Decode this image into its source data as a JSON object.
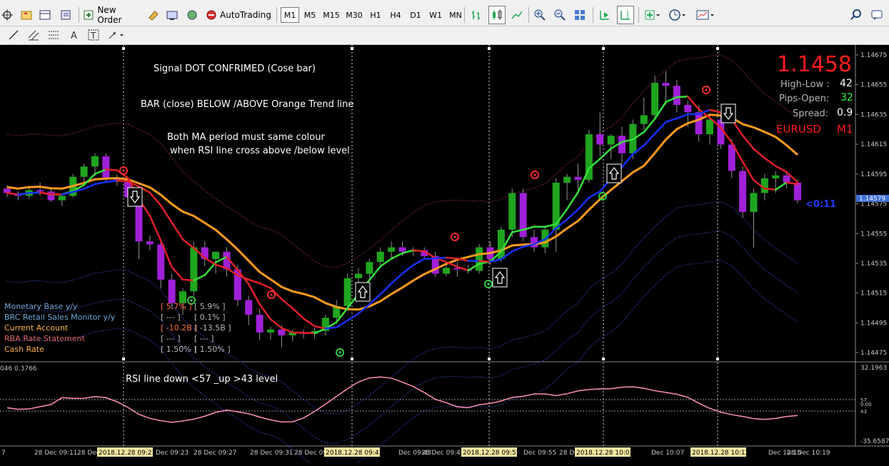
{
  "toolbar": {
    "new_order": "New Order",
    "autotrading": "AutoTrading",
    "timeframes": [
      "M1",
      "M5",
      "M15",
      "M30",
      "H1",
      "H4",
      "D1",
      "W1",
      "MN"
    ],
    "active_timeframe": "M1"
  },
  "overlay_text": {
    "line1": "Signal DOT CONFRIMED (Cose bar)",
    "line2": "BAR (close) BELOW /ABOVE Orange Trend line",
    "line3": "Both MA period must same colour",
    "line4": "when RSI line cross above /below level",
    "rsi_note": "RSI line  down <57 _up >43 level"
  },
  "info_panel": {
    "price": "1.1458",
    "high_low_label": "High-Low :",
    "high_low_value": "42",
    "pips_open_label": "Pips-Open:",
    "pips_open_value": "32",
    "spread_label": "Spread:",
    "spread_value": "0.9",
    "symbol": "EURUSD",
    "timeframe": "M1",
    "countdown": "<0:11"
  },
  "news_panel": [
    {
      "name": "Monetary Base y/y",
      "actual": "",
      "forecast": "",
      "color": "#6fa8dc"
    },
    {
      "name": "BRC Retail Sales Monitor y/y",
      "actual": "",
      "forecast": "",
      "color": "#6fa8dc"
    },
    {
      "name": "Current Account",
      "actual": "[ -10.2B ]",
      "forecast": "[ -13.5B ]",
      "color": "#ffb347"
    },
    {
      "name": "RBA Rate Statement",
      "actual": "[ --- ]",
      "forecast": "[ --- ]",
      "color": "#e06666"
    },
    {
      "name": "Cash Rate",
      "actual": "[ 1.50% ]",
      "forecast": "[ 1.50% ]",
      "color": "#ffb347"
    }
  ],
  "news_values_top": [
    {
      "actual": "[ 5.7% ]",
      "forecast": "[ 5.9% ]"
    },
    {
      "actual": "[ --- ]",
      "forecast": "[ 0.1% ]"
    }
  ],
  "rsi_header": "046 0.3766",
  "chart_data": {
    "type": "candlestick",
    "symbol": "EURUSD",
    "price_axis": [
      "1.14675",
      "1.14655",
      "1.14635",
      "1.14615",
      "1.14595",
      "1.14575",
      "1.14555",
      "1.14535",
      "1.14515",
      "1.14495",
      "1.14475"
    ],
    "current_price_label": "1.14579",
    "price_range": [
      1.1447,
      1.1468
    ],
    "time_axis": [
      {
        "label": "7",
        "highlight": false
      },
      {
        "label": "28 Dec 09:11",
        "highlight": false
      },
      {
        "label": "28 Dec 09:15",
        "highlight": false
      },
      {
        "label": "2018.12.28 09:21",
        "highlight": true
      },
      {
        "label": "Dec 09:23",
        "highlight": false
      },
      {
        "label": "28 Dec 09:27",
        "highlight": false
      },
      {
        "label": "28 Dec 09:31",
        "highlight": false
      },
      {
        "label": "28 Dec 09:35",
        "highlight": false
      },
      {
        "label": "2018.12.28 09:41",
        "highlight": true
      },
      {
        "label": "Dec 09:43",
        "highlight": false
      },
      {
        "label": "28 Dec 09:47",
        "highlight": false
      },
      {
        "label": "2018.12.28 09:53",
        "highlight": true
      },
      {
        "label": "Dec 09:55",
        "highlight": false
      },
      {
        "label": "28 Dec 09:59",
        "highlight": false
      },
      {
        "label": "2018.12.28 10:03",
        "highlight": true
      },
      {
        "label": "Dec 10:07",
        "highlight": false
      },
      {
        "label": "2018.12.28 10:13",
        "highlight": true
      },
      {
        "label": "Dec 10:15",
        "highlight": false
      },
      {
        "label": "28 Dec 10:19",
        "highlight": false
      }
    ],
    "rsi_axis": [
      "32.1963",
      "57",
      "0.00",
      "43",
      "-35.6587"
    ],
    "candles": [
      {
        "o": 1.14588,
        "h": 1.1459,
        "l": 1.14582,
        "c": 1.14585
      },
      {
        "o": 1.14584,
        "h": 1.14586,
        "l": 1.1458,
        "c": 1.14583
      },
      {
        "o": 1.14583,
        "h": 1.1459,
        "l": 1.14581,
        "c": 1.14587
      },
      {
        "o": 1.14587,
        "h": 1.14592,
        "l": 1.14583,
        "c": 1.14586
      },
      {
        "o": 1.14586,
        "h": 1.14589,
        "l": 1.14579,
        "c": 1.1458
      },
      {
        "o": 1.1458,
        "h": 1.14584,
        "l": 1.14576,
        "c": 1.14583
      },
      {
        "o": 1.14583,
        "h": 1.14598,
        "l": 1.14582,
        "c": 1.14596
      },
      {
        "o": 1.14596,
        "h": 1.14605,
        "l": 1.14592,
        "c": 1.14603
      },
      {
        "o": 1.14603,
        "h": 1.14612,
        "l": 1.14598,
        "c": 1.1461
      },
      {
        "o": 1.1461,
        "h": 1.14612,
        "l": 1.14592,
        "c": 1.14595
      },
      {
        "o": 1.14595,
        "h": 1.14598,
        "l": 1.1459,
        "c": 1.14594
      },
      {
        "o": 1.14594,
        "h": 1.14596,
        "l": 1.14578,
        "c": 1.14582
      },
      {
        "o": 1.14582,
        "h": 1.14584,
        "l": 1.1454,
        "c": 1.14552
      },
      {
        "o": 1.14552,
        "h": 1.14556,
        "l": 1.14546,
        "c": 1.1455
      },
      {
        "o": 1.1455,
        "h": 1.14552,
        "l": 1.1452,
        "c": 1.14526
      },
      {
        "o": 1.14526,
        "h": 1.1453,
        "l": 1.14506,
        "c": 1.1451
      },
      {
        "o": 1.1451,
        "h": 1.1452,
        "l": 1.14502,
        "c": 1.14518
      },
      {
        "o": 1.14518,
        "h": 1.14552,
        "l": 1.14515,
        "c": 1.14548
      },
      {
        "o": 1.14548,
        "h": 1.14552,
        "l": 1.14535,
        "c": 1.1454
      },
      {
        "o": 1.1454,
        "h": 1.14545,
        "l": 1.1453,
        "c": 1.14545
      },
      {
        "o": 1.14545,
        "h": 1.14548,
        "l": 1.14528,
        "c": 1.14533
      },
      {
        "o": 1.14533,
        "h": 1.14536,
        "l": 1.14508,
        "c": 1.14512
      },
      {
        "o": 1.14512,
        "h": 1.14515,
        "l": 1.14495,
        "c": 1.14502
      },
      {
        "o": 1.14502,
        "h": 1.14506,
        "l": 1.14485,
        "c": 1.1449
      },
      {
        "o": 1.1449,
        "h": 1.14494,
        "l": 1.14485,
        "c": 1.14492
      },
      {
        "o": 1.14492,
        "h": 1.14495,
        "l": 1.1448,
        "c": 1.14488
      },
      {
        "o": 1.14488,
        "h": 1.14492,
        "l": 1.14484,
        "c": 1.1449
      },
      {
        "o": 1.1449,
        "h": 1.14492,
        "l": 1.14486,
        "c": 1.14489
      },
      {
        "o": 1.14489,
        "h": 1.14493,
        "l": 1.14486,
        "c": 1.14491
      },
      {
        "o": 1.14491,
        "h": 1.14502,
        "l": 1.14488,
        "c": 1.145
      },
      {
        "o": 1.145,
        "h": 1.14512,
        "l": 1.14496,
        "c": 1.14508
      },
      {
        "o": 1.14508,
        "h": 1.1453,
        "l": 1.14505,
        "c": 1.14527
      },
      {
        "o": 1.14527,
        "h": 1.14534,
        "l": 1.14522,
        "c": 1.1453
      },
      {
        "o": 1.1453,
        "h": 1.1454,
        "l": 1.14526,
        "c": 1.14538
      },
      {
        "o": 1.14538,
        "h": 1.14548,
        "l": 1.14535,
        "c": 1.14545
      },
      {
        "o": 1.14545,
        "h": 1.14552,
        "l": 1.1454,
        "c": 1.14548
      },
      {
        "o": 1.14548,
        "h": 1.14552,
        "l": 1.14542,
        "c": 1.14545
      },
      {
        "o": 1.14545,
        "h": 1.14548,
        "l": 1.14542,
        "c": 1.14546
      },
      {
        "o": 1.14546,
        "h": 1.14548,
        "l": 1.1454,
        "c": 1.14542
      },
      {
        "o": 1.14542,
        "h": 1.14545,
        "l": 1.14528,
        "c": 1.1453
      },
      {
        "o": 1.1453,
        "h": 1.14536,
        "l": 1.14528,
        "c": 1.14534
      },
      {
        "o": 1.14534,
        "h": 1.14538,
        "l": 1.14528,
        "c": 1.14533
      },
      {
        "o": 1.14533,
        "h": 1.14536,
        "l": 1.1453,
        "c": 1.14532
      },
      {
        "o": 1.14532,
        "h": 1.1455,
        "l": 1.1453,
        "c": 1.14548
      },
      {
        "o": 1.14548,
        "h": 1.14552,
        "l": 1.14536,
        "c": 1.1454
      },
      {
        "o": 1.1454,
        "h": 1.14562,
        "l": 1.14538,
        "c": 1.1456
      },
      {
        "o": 1.1456,
        "h": 1.14588,
        "l": 1.14555,
        "c": 1.14585
      },
      {
        "o": 1.14585,
        "h": 1.14588,
        "l": 1.14552,
        "c": 1.14555
      },
      {
        "o": 1.14555,
        "h": 1.1456,
        "l": 1.14545,
        "c": 1.14548
      },
      {
        "o": 1.14548,
        "h": 1.14562,
        "l": 1.14544,
        "c": 1.1456
      },
      {
        "o": 1.1456,
        "h": 1.14595,
        "l": 1.14545,
        "c": 1.14592
      },
      {
        "o": 1.14592,
        "h": 1.14598,
        "l": 1.1458,
        "c": 1.14596
      },
      {
        "o": 1.14596,
        "h": 1.14605,
        "l": 1.14585,
        "c": 1.14594
      },
      {
        "o": 1.14594,
        "h": 1.14628,
        "l": 1.14592,
        "c": 1.14625
      },
      {
        "o": 1.14625,
        "h": 1.1464,
        "l": 1.1461,
        "c": 1.14618
      },
      {
        "o": 1.14618,
        "h": 1.14625,
        "l": 1.14608,
        "c": 1.14624
      },
      {
        "o": 1.14624,
        "h": 1.1463,
        "l": 1.14605,
        "c": 1.14612
      },
      {
        "o": 1.14612,
        "h": 1.14635,
        "l": 1.14608,
        "c": 1.14632
      },
      {
        "o": 1.14632,
        "h": 1.1465,
        "l": 1.14628,
        "c": 1.14638
      },
      {
        "o": 1.14638,
        "h": 1.14665,
        "l": 1.14635,
        "c": 1.1466
      },
      {
        "o": 1.1466,
        "h": 1.14668,
        "l": 1.14645,
        "c": 1.14658
      },
      {
        "o": 1.14658,
        "h": 1.14662,
        "l": 1.1464,
        "c": 1.14645
      },
      {
        "o": 1.14645,
        "h": 1.14648,
        "l": 1.1463,
        "c": 1.1464
      },
      {
        "o": 1.1464,
        "h": 1.14645,
        "l": 1.1462,
        "c": 1.14625
      },
      {
        "o": 1.14625,
        "h": 1.14638,
        "l": 1.14618,
        "c": 1.14635
      },
      {
        "o": 1.14635,
        "h": 1.14638,
        "l": 1.14615,
        "c": 1.14618
      },
      {
        "o": 1.14618,
        "h": 1.14622,
        "l": 1.14595,
        "c": 1.146
      },
      {
        "o": 1.146,
        "h": 1.14603,
        "l": 1.14568,
        "c": 1.14572
      },
      {
        "o": 1.14572,
        "h": 1.14588,
        "l": 1.14548,
        "c": 1.14585
      },
      {
        "o": 1.14585,
        "h": 1.14598,
        "l": 1.1458,
        "c": 1.14595
      },
      {
        "o": 1.14595,
        "h": 1.146,
        "l": 1.14585,
        "c": 1.14597
      },
      {
        "o": 1.14597,
        "h": 1.146,
        "l": 1.14588,
        "c": 1.14592
      },
      {
        "o": 1.14592,
        "h": 1.14594,
        "l": 1.14578,
        "c": 1.1458
      }
    ]
  }
}
